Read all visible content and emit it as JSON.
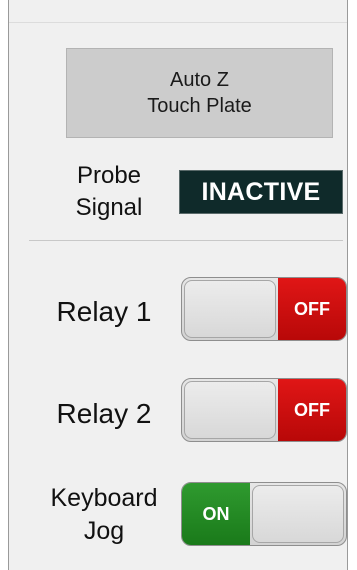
{
  "touch_plate": {
    "line1": "Auto Z",
    "line2": "Touch Plate"
  },
  "probe": {
    "label_line1": "Probe",
    "label_line2": "Signal",
    "status": "INACTIVE"
  },
  "relay1": {
    "label": "Relay 1",
    "state": "OFF"
  },
  "relay2": {
    "label": "Relay 2",
    "state": "OFF"
  },
  "keyboard_jog": {
    "label_line1": "Keyboard",
    "label_line2": "Jog",
    "state": "ON"
  },
  "colors": {
    "off": "#d10f0f",
    "on": "#238a23",
    "badge": "#0f2a2a"
  }
}
